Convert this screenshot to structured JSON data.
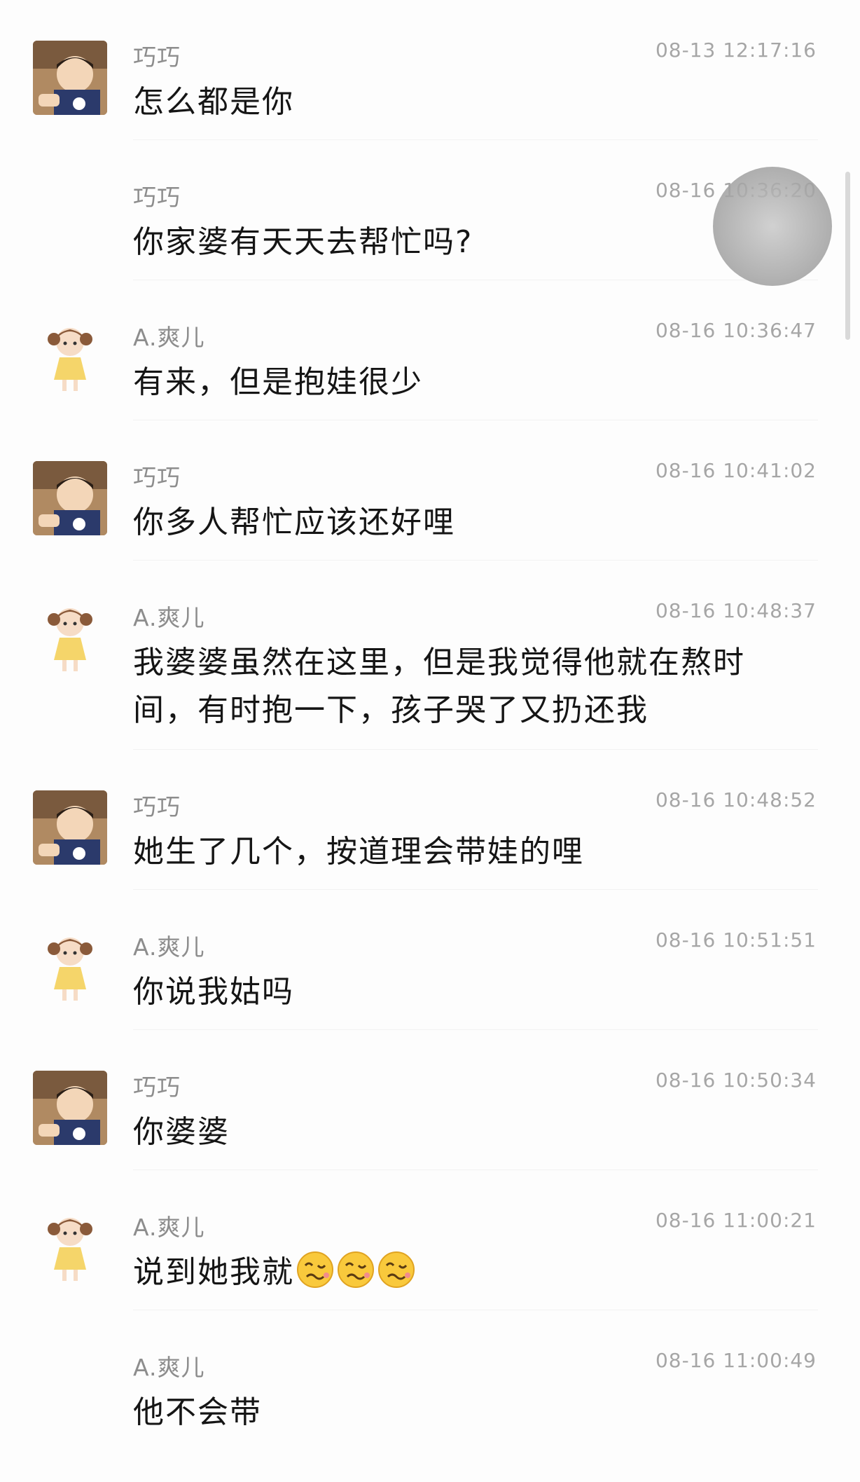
{
  "messages": [
    {
      "sender": "巧巧",
      "time": "08-13 12:17:16",
      "text": "怎么都是你",
      "avatar": "boy-avatar"
    },
    {
      "sender": "巧巧",
      "time": "08-16 10:36:20",
      "text": "你家婆有天天去帮忙吗?",
      "avatar": ""
    },
    {
      "sender": "A.爽儿",
      "time": "08-16 10:36:47",
      "text": "有来，但是抱娃很少",
      "avatar": "girl-avatar"
    },
    {
      "sender": "巧巧",
      "time": "08-16 10:41:02",
      "text": "你多人帮忙应该还好哩",
      "avatar": "boy-avatar"
    },
    {
      "sender": "A.爽儿",
      "time": "08-16 10:48:37",
      "text": "我婆婆虽然在这里，但是我觉得他就在熬时间，有时抱一下，孩子哭了又扔还我",
      "avatar": "girl-avatar"
    },
    {
      "sender": "巧巧",
      "time": "08-16 10:48:52",
      "text": "她生了几个，按道理会带娃的哩",
      "avatar": "boy-avatar"
    },
    {
      "sender": "A.爽儿",
      "time": "08-16 10:51:51",
      "text": "你说我姑吗",
      "avatar": "girl-avatar"
    },
    {
      "sender": "巧巧",
      "time": "08-16 10:50:34",
      "text": "你婆婆",
      "avatar": "boy-avatar"
    },
    {
      "sender": "A.爽儿",
      "time": "08-16 11:00:21",
      "text": "说到她我就",
      "emoji_count": 3,
      "emoji": "woozy-face-icon",
      "avatar": "girl-avatar"
    },
    {
      "sender": "A.爽儿",
      "time": "08-16 11:00:49",
      "text": "他不会带",
      "avatar": ""
    }
  ],
  "colors": {
    "sender": "#8d8d8d",
    "time": "#a6a6a6",
    "text": "#151515",
    "background": "#fdfdfd"
  }
}
